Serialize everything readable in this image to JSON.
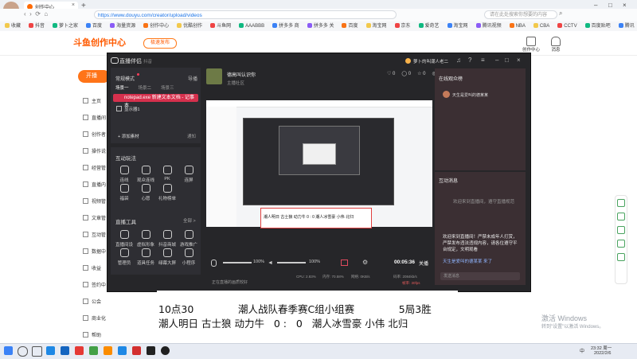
{
  "browser": {
    "tab_title": "创作中心",
    "url": "https://www.douyu.com/creator/upload/videos",
    "search_placeholder": "请在此处搜索你想要的内容",
    "bookmarks": [
      "收藏",
      "抖音",
      "萝卜之家",
      "百度",
      "海量资源",
      "创作中心",
      "优酷创作",
      "斗鱼网",
      "AAABBB",
      "拼多多 商",
      "拼多多 关",
      "百度",
      "淘宝网",
      "京东",
      "爱奇艺",
      "淘宝网",
      "腾讯视频",
      "NBA",
      "CBA",
      "CCTV",
      "百度贴吧",
      "腾讯",
      "CBA"
    ]
  },
  "site": {
    "logo_text": "斗鱼创作中心",
    "pill_label": "极速发布",
    "creator_center": "创作中心",
    "messages": "消息",
    "start_button": "开播",
    "nav": [
      "主页",
      "直播间",
      "创作者",
      "操作说",
      "经营管",
      "直播内",
      "视频管",
      "文章管",
      "互动管",
      "数据中",
      "收益",
      "签约中",
      "公会",
      "商业化",
      "帮助"
    ]
  },
  "obs": {
    "app_name": "直播伴侣",
    "app_sub": "抖音",
    "mode_label": "常规模式",
    "mode_action": "导播",
    "scene_tabs": [
      "场景一",
      "场景二",
      "场景三"
    ],
    "active_source": "notepad.exe 新建文本文档 - 记事本",
    "source2": "显示器1",
    "add_material": "+ 添加素材",
    "add_hint": "通知",
    "interaction_title": "互动玩法",
    "interaction_items": [
      "连线",
      "观众连线",
      "PK",
      "连屏",
      "福袋",
      "心愿",
      "礼物榜单"
    ],
    "tools_title": "直播工具",
    "tools_more": "全部 >",
    "tools_items": [
      "直播间设",
      "虚拟形象",
      "抖音商城",
      "游戏推广",
      "管理员",
      "道具任务",
      "绿幕大屏",
      "小程序"
    ],
    "room_title": "德高叫认识你",
    "room_sub": "主播社区",
    "user_name": "萝卜的叫潮人老二",
    "stats": [
      "0",
      "0",
      "0",
      "0"
    ],
    "online_title": "在线观众榜",
    "online_user": "天生是爱叫的德某某",
    "interact_title": "互动消息",
    "chat_welcome": "欢迎来到直播间，遵守直播规范",
    "chat_msg": "欢迎来到直播间！严禁未成年人打赏，严禁发布违法违规内容，请各位遵守平台规定，文明观看",
    "chat_join": "天生是爱叫的德某某 来了",
    "chat_placeholder": "发送消息",
    "volume_mic": "100%",
    "volume_sys": "100%",
    "timer": "00:05:36",
    "status_btn": "关播",
    "bottom_hint": "正在直播的画质较好",
    "cpu": "CPU: 2.83%",
    "memory": "内存: 70.58%",
    "network": "网络: 0KB/s",
    "bitrate": "码率: 2084kb/s",
    "fps": "帧率: 30fps"
  },
  "overlay": {
    "line1": "10点30              潮人战队春季赛C组小组赛              5局3胜",
    "line2": "潮人明日 古士狼 动力牛   0 :   0   潮人冰雪豪 小伟 北归",
    "preview_line": "潮人明日 古士狼 动力牛  0 :  0  潮人冰雪豪 小伟 北归"
  },
  "windows": {
    "activate_title": "激活 Windows",
    "activate_sub": "转到\"设置\"以激活 Windows。",
    "time": "23:32 周一",
    "date": "2022/2/6",
    "lang": "中"
  }
}
